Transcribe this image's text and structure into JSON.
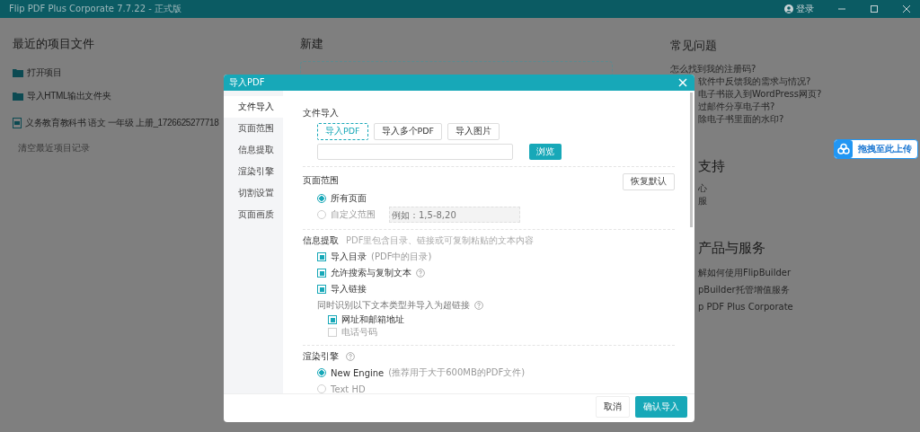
{
  "titlebar": {
    "title": "Flip PDF Plus Corporate 7.7.22 - 正式版",
    "login": "登录"
  },
  "recent": {
    "title": "最近的项目文件",
    "actions": [
      "打开项目",
      "导入HTML输出文件夹"
    ],
    "files": [
      "义务教育教科书 语文 一年级 上册_1726625277718"
    ],
    "clear": "清空最近项目记录"
  },
  "create": {
    "title": "新建"
  },
  "faq": {
    "title": "常见问题",
    "items": [
      "怎么找到我的注册码?",
      "软件中反馈我的需求与情况?",
      "电子书嵌入到WordPress网页?",
      "过邮件分享电子书?",
      "除电子书里面的水印?"
    ]
  },
  "support": {
    "title": "支持",
    "items": [
      "心",
      "服"
    ]
  },
  "products": {
    "title": "产品与服务",
    "items": [
      "解如何使用FlipBuilder",
      "pBuilder托管增值服务",
      "p PDF Plus Corporate"
    ]
  },
  "upload_widget": {
    "label": "拖拽至此上传"
  },
  "dialog": {
    "title": "导入PDF",
    "nav": [
      {
        "label": "文件导入",
        "selected": true
      },
      {
        "label": "页面范围",
        "selected": false
      },
      {
        "label": "信息提取",
        "selected": false
      },
      {
        "label": "渲染引擎",
        "selected": false
      },
      {
        "label": "切割设置",
        "selected": false
      },
      {
        "label": "页面画质",
        "selected": false
      }
    ],
    "file_import": {
      "title": "文件导入",
      "modes": [
        {
          "label": "导入PDF",
          "selected": true
        },
        {
          "label": "导入多个PDF",
          "selected": false
        },
        {
          "label": "导入图片",
          "selected": false
        }
      ],
      "browse": "浏览"
    },
    "page_range": {
      "title": "页面范围",
      "reset": "恢复默认",
      "options": [
        {
          "label": "所有页面",
          "selected": true
        },
        {
          "label": "自定义范围",
          "selected": false,
          "placeholder": "例如：1,5-8,20"
        }
      ]
    },
    "info": {
      "title": "信息提取",
      "hint": "PDF里包含目录、链接或可复制粘贴的文本内容",
      "options": [
        {
          "label": "导入目录",
          "note": "(PDF中的目录)",
          "checked": true
        },
        {
          "label": "允许搜索与复制文本",
          "checked": true,
          "help": true
        },
        {
          "label": "导入链接",
          "checked": true
        }
      ],
      "link_hint": "同时识别以下文本类型并导入为超链接",
      "link_types": [
        {
          "label": "网址和邮箱地址",
          "checked": true
        },
        {
          "label": "电话号码",
          "checked": false
        }
      ]
    },
    "engine": {
      "title": "渲染引擎",
      "options": [
        {
          "label": "New Engine",
          "note": "(推荐用于大于600MB的PDF文件)",
          "selected": true
        },
        {
          "label": "Text HD",
          "selected": false
        }
      ]
    },
    "buttons": {
      "cancel": "取消",
      "confirm": "确认导入"
    }
  }
}
